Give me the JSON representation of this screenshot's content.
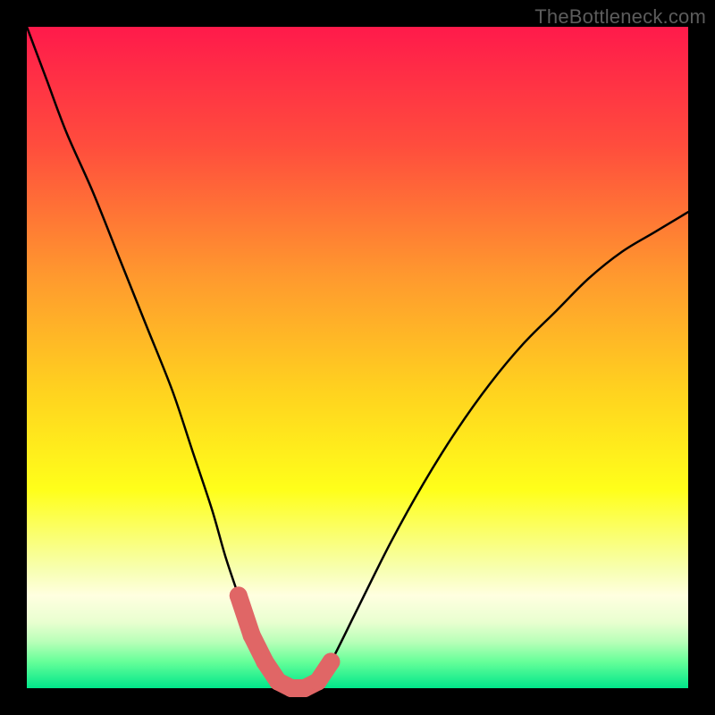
{
  "watermark": {
    "text": "TheBottleneck.com"
  },
  "colors": {
    "frame": "#000000",
    "gradient_stops": [
      {
        "pct": 0,
        "color": "#ff1a4b"
      },
      {
        "pct": 18,
        "color": "#ff4d3d"
      },
      {
        "pct": 38,
        "color": "#ff9a2e"
      },
      {
        "pct": 55,
        "color": "#ffd21f"
      },
      {
        "pct": 70,
        "color": "#ffff1a"
      },
      {
        "pct": 82,
        "color": "#f7ffb0"
      },
      {
        "pct": 86,
        "color": "#ffffe0"
      },
      {
        "pct": 90,
        "color": "#e9ffd0"
      },
      {
        "pct": 93,
        "color": "#b8ffb8"
      },
      {
        "pct": 96,
        "color": "#66ff99"
      },
      {
        "pct": 100,
        "color": "#00e68a"
      }
    ],
    "curve": "#000000",
    "markers": "#e06666"
  },
  "chart_data": {
    "type": "line",
    "title": "",
    "xlabel": "",
    "ylabel": "",
    "xlim": [
      0,
      100
    ],
    "ylim": [
      0,
      100
    ],
    "grid": false,
    "legend": false,
    "series": [
      {
        "name": "bottleneck-curve",
        "x": [
          0,
          3,
          6,
          10,
          14,
          18,
          22,
          25,
          28,
          30,
          32,
          34,
          36,
          38,
          40,
          42,
          44,
          46,
          50,
          55,
          60,
          65,
          70,
          75,
          80,
          85,
          90,
          95,
          100
        ],
        "values": [
          100,
          92,
          84,
          75,
          65,
          55,
          45,
          36,
          27,
          20,
          14,
          8,
          4,
          1,
          0,
          0,
          1,
          4,
          12,
          22,
          31,
          39,
          46,
          52,
          57,
          62,
          66,
          69,
          72
        ]
      }
    ],
    "markers": {
      "name": "valley-markers",
      "x": [
        32,
        34,
        36,
        38,
        40,
        42,
        44,
        46
      ],
      "values": [
        14,
        8,
        4,
        1,
        0,
        0,
        1,
        4
      ]
    }
  }
}
